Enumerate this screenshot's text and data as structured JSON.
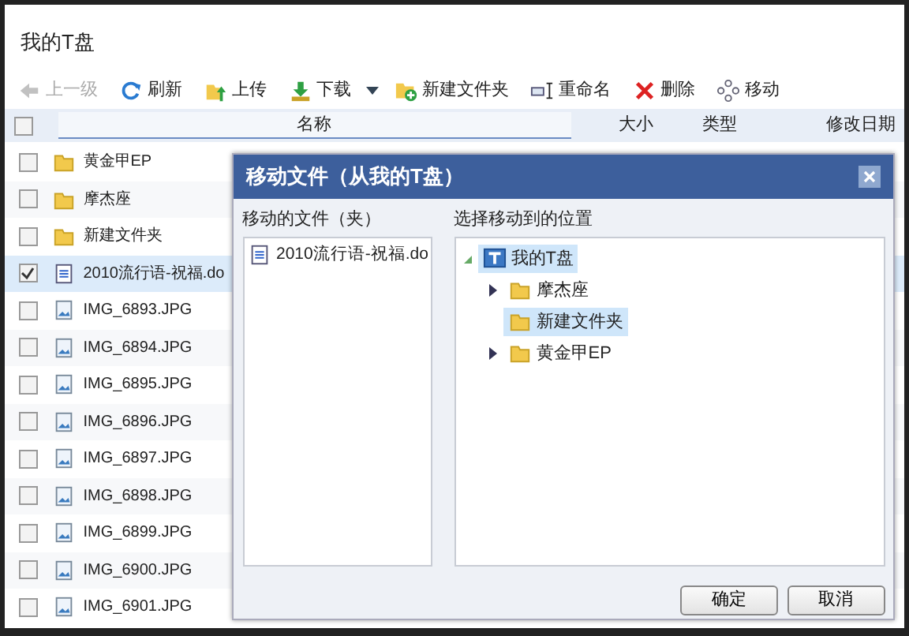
{
  "window": {
    "title": "我的T盘"
  },
  "toolbar": [
    {
      "label": "上一级",
      "kind": "up",
      "disabled": true
    },
    {
      "label": "刷新",
      "kind": "refresh",
      "disabled": false
    },
    {
      "label": "上传",
      "kind": "upload",
      "disabled": false
    },
    {
      "label": "下载",
      "kind": "download",
      "disabled": false
    },
    {
      "label": "新建文件夹",
      "kind": "newfolder",
      "disabled": false
    },
    {
      "label": "重命名",
      "kind": "rename",
      "disabled": false
    },
    {
      "label": "删除",
      "kind": "delete",
      "disabled": false
    },
    {
      "label": "移动",
      "kind": "move",
      "disabled": false
    }
  ],
  "table": {
    "select_all": {
      "checked": false
    },
    "columns": [
      "名称",
      "大小",
      "类型",
      "修改日期"
    ],
    "rows": [
      {
        "name": "黄金甲EP",
        "kind": "folder",
        "checked": false,
        "selected": false
      },
      {
        "name": "摩杰座",
        "kind": "folder",
        "checked": false,
        "selected": false
      },
      {
        "name": "新建文件夹",
        "kind": "folder",
        "checked": false,
        "selected": false
      },
      {
        "name": "2010流行语-祝福.do",
        "kind": "doc",
        "checked": true,
        "selected": true
      },
      {
        "name": "IMG_6893.JPG",
        "kind": "image",
        "checked": false,
        "selected": false
      },
      {
        "name": "IMG_6894.JPG",
        "kind": "image",
        "checked": false,
        "selected": false
      },
      {
        "name": "IMG_6895.JPG",
        "kind": "image",
        "checked": false,
        "selected": false
      },
      {
        "name": "IMG_6896.JPG",
        "kind": "image",
        "checked": false,
        "selected": false
      },
      {
        "name": "IMG_6897.JPG",
        "kind": "image",
        "checked": false,
        "selected": false
      },
      {
        "name": "IMG_6898.JPG",
        "kind": "image",
        "checked": false,
        "selected": false
      },
      {
        "name": "IMG_6899.JPG",
        "kind": "image",
        "checked": false,
        "selected": false
      },
      {
        "name": "IMG_6900.JPG",
        "kind": "image",
        "checked": false,
        "selected": false
      },
      {
        "name": "IMG_6901.JPG",
        "kind": "image",
        "checked": false,
        "selected": false
      }
    ]
  },
  "dialog": {
    "title": "移动文件（从我的T盘）",
    "files_label": "移动的文件（夹）",
    "files": [
      {
        "name": "2010流行语-祝福.do",
        "kind": "doc"
      }
    ],
    "target_label": "选择移动到的位置",
    "tree": [
      {
        "label": "我的T盘",
        "kind": "drive",
        "expanded": true,
        "selected": true,
        "children": [
          {
            "label": "摩杰座",
            "kind": "folder",
            "expanded": false,
            "selected": false
          },
          {
            "label": "新建文件夹",
            "kind": "folder",
            "selected": true
          },
          {
            "label": "黄金甲EP",
            "kind": "folder",
            "expanded": false,
            "selected": false
          }
        ]
      }
    ],
    "buttons": [
      "确定",
      "取消"
    ]
  }
}
